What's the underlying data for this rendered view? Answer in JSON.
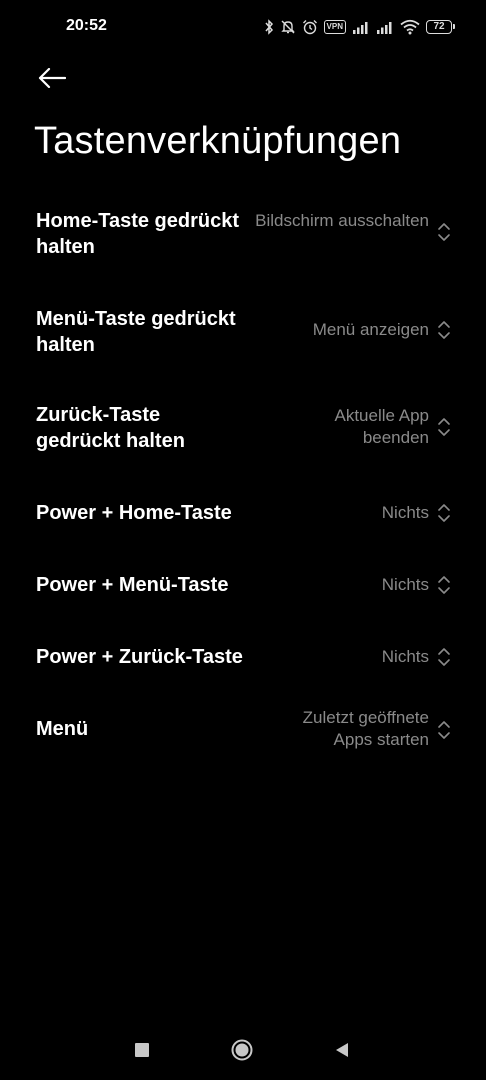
{
  "status_bar": {
    "time": "20:52",
    "vpn_label": "VPN",
    "battery_level": "72",
    "icons": [
      "bluetooth-icon",
      "mute-icon",
      "alarm-icon",
      "vpn-icon",
      "signal-icon",
      "signal-icon",
      "wifi-icon",
      "battery-icon"
    ]
  },
  "header": {
    "back_icon": "arrow-left-icon",
    "title": "Tastenverknüpfungen"
  },
  "settings": [
    {
      "label": "Home-Taste gedrückt halten",
      "value": "Bildschirm ausschalten"
    },
    {
      "label": "Menü-Taste gedrückt halten",
      "value": "Menü anzeigen"
    },
    {
      "label": "Zurück-Taste gedrückt halten",
      "value": "Aktuelle App beenden"
    },
    {
      "label": "Power + Home-Taste",
      "value": "Nichts"
    },
    {
      "label": "Power + Menü-Taste",
      "value": "Nichts"
    },
    {
      "label": "Power + Zurück-Taste",
      "value": "Nichts"
    },
    {
      "label": "Menü",
      "value": "Zuletzt geöffnete Apps starten"
    }
  ],
  "nav_bar": {
    "icons": [
      "recents-square-icon",
      "home-circle-icon",
      "back-triangle-icon"
    ]
  },
  "colors": {
    "background": "#000000",
    "primary_text": "#ffffff",
    "secondary_text": "#8a8a8a"
  }
}
